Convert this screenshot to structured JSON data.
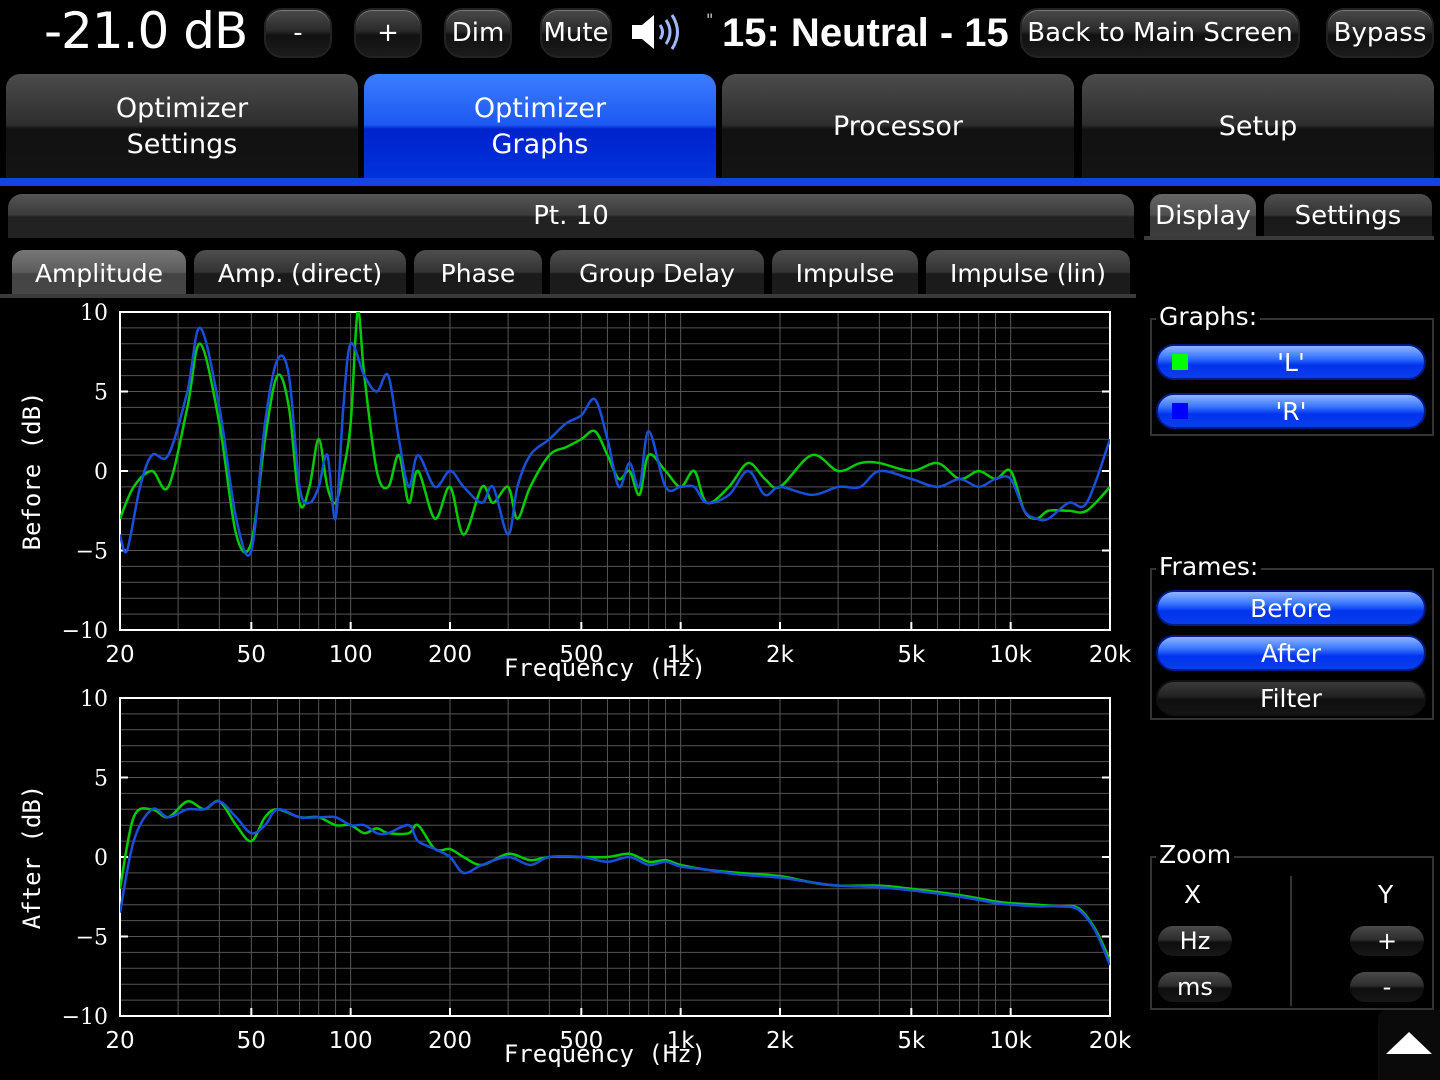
{
  "top": {
    "volume": "-21.0 dB",
    "minus": "-",
    "plus": "+",
    "dim": "Dim",
    "mute": "Mute",
    "preset_prefix": "\"",
    "preset": "15: Neutral - 15",
    "back": "Back to Main Screen",
    "bypass": "Bypass"
  },
  "main_tabs": [
    {
      "label": "Optimizer\nSettings",
      "active": false
    },
    {
      "label": "Optimizer\nGraphs",
      "active": true
    },
    {
      "label": "Processor",
      "active": false
    },
    {
      "label": "Setup",
      "active": false
    }
  ],
  "section": {
    "title": "Pt. 10"
  },
  "sub_tabs": [
    "Amplitude",
    "Amp. (direct)",
    "Phase",
    "Group Delay",
    "Impulse",
    "Impulse (lin)"
  ],
  "right_panel": {
    "tabs": [
      "Display",
      "Settings"
    ],
    "graphs_label": "Graphs:",
    "graphs": [
      {
        "label": "'L'",
        "color": "#00ff00"
      },
      {
        "label": "'R'",
        "color": "#0000ff"
      }
    ],
    "frames_label": "Frames:",
    "frames": [
      {
        "label": "Before",
        "on": true
      },
      {
        "label": "After",
        "on": true
      },
      {
        "label": "Filter",
        "on": false
      }
    ],
    "zoom_label": "Zoom",
    "zoom_x": "X",
    "zoom_y": "Y",
    "zoom_hz": "Hz",
    "zoom_ms": "ms",
    "zoom_plus": "+",
    "zoom_minus": "-"
  },
  "colors": {
    "accent": "#1544e0",
    "left": "#00cc00",
    "right": "#1a4fd8"
  },
  "chart_data": [
    {
      "type": "line",
      "xlabel": "Frequency (Hz)",
      "ylabel": "Before (dB)",
      "xscale": "log",
      "xlim": [
        20,
        20000
      ],
      "ylim": [
        -10,
        10
      ],
      "yticks": [
        -10,
        -5,
        0,
        5,
        10
      ],
      "xticks": [
        20,
        50,
        100,
        200,
        500,
        1000,
        2000,
        5000,
        10000,
        20000
      ],
      "xtick_labels": [
        "20",
        "50",
        "100",
        "200",
        "500",
        "1k",
        "2k",
        "5k",
        "10k",
        "20k"
      ],
      "grid": true,
      "series": [
        {
          "name": "'L'",
          "color": "#00cc00",
          "x": [
            20,
            22,
            25,
            28,
            32,
            35,
            40,
            45,
            50,
            55,
            60,
            65,
            70,
            75,
            80,
            85,
            90,
            95,
            100,
            105,
            110,
            120,
            130,
            140,
            150,
            160,
            180,
            200,
            220,
            250,
            270,
            300,
            320,
            350,
            400,
            450,
            500,
            550,
            600,
            650,
            700,
            750,
            800,
            900,
            1000,
            1100,
            1200,
            1400,
            1600,
            1800,
            2000,
            2500,
            3000,
            3500,
            4000,
            5000,
            6000,
            7000,
            8000,
            9000,
            10000,
            11000,
            12000,
            13000,
            15000,
            17000,
            20000
          ],
          "y": [
            -3,
            -1,
            0,
            -1,
            4,
            8,
            3,
            -4,
            -4.5,
            2,
            6,
            4,
            -2,
            -1,
            2,
            -1,
            -2,
            0,
            3,
            10,
            6,
            0,
            -1,
            1,
            -2,
            0,
            -3,
            -1,
            -4,
            -1,
            -2,
            -1,
            -3,
            -1,
            1,
            1.5,
            2,
            2.5,
            1,
            -0.5,
            0,
            -1.5,
            1,
            0,
            -1,
            0,
            -2,
            -1,
            0.5,
            -0.5,
            -1,
            1,
            0,
            0.5,
            0.5,
            0,
            0.5,
            -0.5,
            0,
            -0.5,
            0,
            -2.5,
            -3,
            -2.5,
            -2.5,
            -2.5,
            -1
          ]
        },
        {
          "name": "'R'",
          "color": "#1a4fd8",
          "x": [
            20,
            21,
            23,
            25,
            28,
            32,
            35,
            40,
            45,
            50,
            55,
            60,
            65,
            70,
            75,
            80,
            85,
            90,
            95,
            100,
            110,
            120,
            130,
            140,
            150,
            160,
            180,
            200,
            220,
            250,
            270,
            300,
            320,
            350,
            400,
            450,
            500,
            550,
            600,
            650,
            700,
            750,
            800,
            900,
            1000,
            1100,
            1200,
            1400,
            1600,
            1800,
            2000,
            2500,
            3000,
            3500,
            4000,
            5000,
            6000,
            7000,
            8000,
            9000,
            10000,
            11000,
            12000,
            13000,
            15000,
            17000,
            20000
          ],
          "y": [
            -4,
            -5,
            -1,
            1,
            1,
            5,
            9,
            4,
            -3,
            -5,
            3,
            7,
            6,
            -1,
            -2,
            -1,
            1,
            -3,
            4,
            8,
            6,
            5,
            6,
            2,
            -1,
            1,
            -1,
            0,
            -1,
            -2,
            -1,
            -4,
            -1,
            1,
            2,
            3,
            3.5,
            4.5,
            2,
            -1,
            0.5,
            -1,
            2.5,
            -1,
            -1,
            -1,
            -2,
            -1.5,
            0,
            -1.5,
            -1,
            -1.5,
            -1,
            -1,
            0,
            -0.5,
            -1,
            -0.5,
            -1,
            -0.5,
            -0.5,
            -2.5,
            -3,
            -3,
            -2,
            -2,
            2
          ]
        }
      ]
    },
    {
      "type": "line",
      "xlabel": "Frequency (Hz)",
      "ylabel": "After (dB)",
      "xscale": "log",
      "xlim": [
        20,
        20000
      ],
      "ylim": [
        -10,
        10
      ],
      "yticks": [
        -10,
        -5,
        0,
        5,
        10
      ],
      "xticks": [
        20,
        50,
        100,
        200,
        500,
        1000,
        2000,
        5000,
        10000,
        20000
      ],
      "xtick_labels": [
        "20",
        "50",
        "100",
        "200",
        "500",
        "1k",
        "2k",
        "5k",
        "10k",
        "20k"
      ],
      "grid": true,
      "series": [
        {
          "name": "'L'",
          "color": "#00cc00",
          "x": [
            20,
            22,
            25,
            28,
            32,
            36,
            40,
            45,
            50,
            55,
            60,
            70,
            80,
            90,
            100,
            110,
            120,
            130,
            150,
            160,
            180,
            200,
            220,
            250,
            300,
            350,
            400,
            500,
            600,
            700,
            800,
            900,
            1000,
            1200,
            1500,
            2000,
            2500,
            3000,
            4000,
            5000,
            6000,
            7000,
            8000,
            9000,
            10000,
            12000,
            14000,
            16000,
            18000,
            20000
          ],
          "y": [
            -2,
            2.5,
            3,
            2.5,
            3.5,
            3,
            3.5,
            2,
            1,
            2.5,
            3,
            2.5,
            2.5,
            2,
            2,
            1.5,
            1.8,
            1.5,
            1.5,
            2,
            0.5,
            0.5,
            0,
            -0.5,
            0.2,
            -0.2,
            0,
            0,
            0,
            0.2,
            -0.3,
            -0.2,
            -0.5,
            -0.8,
            -1,
            -1.2,
            -1.6,
            -1.8,
            -1.8,
            -2,
            -2.2,
            -2.4,
            -2.6,
            -2.8,
            -2.9,
            -3.0,
            -3.1,
            -3.2,
            -4.5,
            -6.5
          ]
        },
        {
          "name": "'R'",
          "color": "#1a4fd8",
          "x": [
            20,
            22,
            25,
            28,
            32,
            36,
            40,
            45,
            50,
            55,
            60,
            70,
            80,
            90,
            100,
            110,
            120,
            130,
            150,
            160,
            180,
            200,
            220,
            250,
            300,
            350,
            400,
            500,
            600,
            700,
            800,
            900,
            1000,
            1200,
            1500,
            2000,
            2500,
            3000,
            4000,
            5000,
            6000,
            7000,
            8000,
            9000,
            10000,
            12000,
            14000,
            16000,
            18000,
            20000
          ],
          "y": [
            -3.5,
            1,
            3,
            2.5,
            3,
            3,
            3.5,
            2.5,
            1.5,
            2,
            3,
            2.5,
            2.5,
            2.5,
            2,
            2,
            1.5,
            1.5,
            2,
            1,
            0.5,
            0,
            -1,
            -0.5,
            0,
            -0.5,
            0,
            0,
            -0.3,
            0,
            -0.5,
            -0.3,
            -0.6,
            -0.8,
            -1.1,
            -1.3,
            -1.6,
            -1.8,
            -1.9,
            -2.1,
            -2.3,
            -2.5,
            -2.7,
            -2.9,
            -3.0,
            -3.1,
            -3.1,
            -3.3,
            -4.6,
            -6.8
          ]
        }
      ]
    }
  ]
}
